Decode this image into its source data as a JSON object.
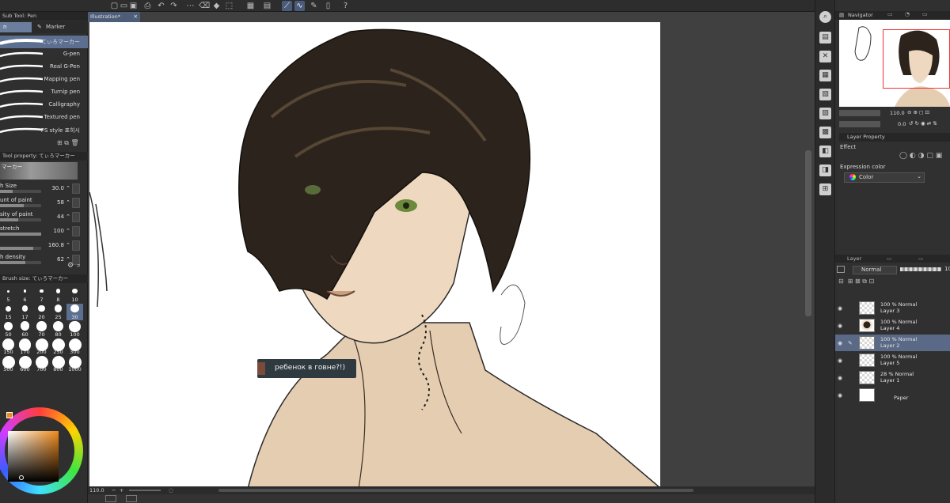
{
  "app": {
    "document_tab": "Illustration*",
    "canvas_zoom": "110.0"
  },
  "left_panel": {
    "subtool_header": "Sub Tool: Pen",
    "tabs": {
      "tab1": "n",
      "tab2": "Marker"
    },
    "brushes": [
      {
        "name": "てぃろマーカー",
        "selected": true
      },
      {
        "name": "G-pen"
      },
      {
        "name": "Real G-Pen"
      },
      {
        "name": "Mapping pen"
      },
      {
        "name": "Turnip pen"
      },
      {
        "name": "Calligraphy"
      },
      {
        "name": "Textured pen"
      },
      {
        "name": "PS style 표히시"
      }
    ],
    "tool_property_header": "Tool property: てぃろマーカー",
    "tool_property_preview": "マーカー",
    "properties": [
      {
        "label": "h Size",
        "value": "30.0",
        "fill": 0.3
      },
      {
        "label": "unt of paint",
        "value": "58",
        "fill": 0.58
      },
      {
        "label": "sity of paint",
        "value": "44",
        "fill": 0.44
      },
      {
        "label": "stretch",
        "value": "100",
        "fill": 1.0
      },
      {
        "label": "",
        "value": "160.8",
        "fill": 0.8
      },
      {
        "label": "h density",
        "value": "62",
        "fill": 0.62
      }
    ],
    "brush_size_header": "Brush size: てぃろマーカー",
    "brush_sizes": [
      "5",
      "6",
      "7",
      "8",
      "10",
      "15",
      "17",
      "20",
      "25",
      "30",
      "50",
      "60",
      "70",
      "80",
      "100",
      "150",
      "170",
      "200",
      "250",
      "300",
      "500",
      "600",
      "700",
      "800",
      "1000"
    ],
    "brush_size_selected": "30"
  },
  "canvas": {
    "comment_text": "ребенок в говне?!)"
  },
  "right_panel": {
    "navigator_header": "Navigator",
    "zoom_value": "110.0",
    "rotation_value": "0.0",
    "layer_property_header": "Layer Property",
    "effect_label": "Effect",
    "expression_color_label": "Expression color",
    "expression_color_value": "Color",
    "layer_header": "Layer",
    "blend_mode": "Normal",
    "opacity_value": "100",
    "layers": [
      {
        "opacity_mode": "100 % Normal",
        "name": "Layer 3",
        "selected": false
      },
      {
        "opacity_mode": "100 % Normal",
        "name": "Layer 4",
        "selected": false
      },
      {
        "opacity_mode": "100 % Normal",
        "name": "Layer 2",
        "selected": true
      },
      {
        "opacity_mode": "100 % Normal",
        "name": "Layer 5",
        "selected": false
      },
      {
        "opacity_mode": "28 % Normal",
        "name": "Layer 1",
        "selected": false
      },
      {
        "opacity_mode": "",
        "name": "Paper",
        "selected": false
      }
    ]
  },
  "colors": {
    "selection": "#5c6f90",
    "accent_red": "#e33333",
    "panel_bg": "#2f2f2f"
  }
}
